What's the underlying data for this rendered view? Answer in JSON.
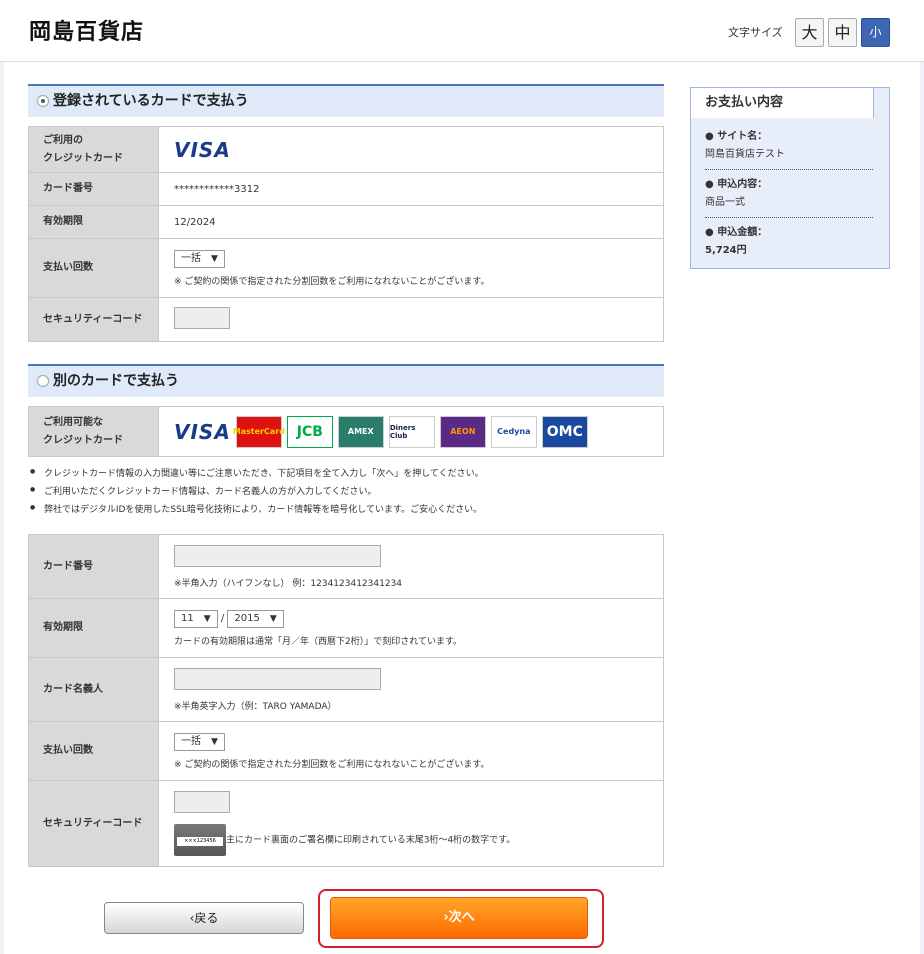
{
  "header": {
    "logo": "岡島百貨店",
    "font_size_label": "文字サイズ",
    "font_size_buttons": [
      "大",
      "中",
      "小"
    ]
  },
  "registered": {
    "heading": "登録されているカードで支払う",
    "card_label": "ご利用の\nクレジットカード",
    "card_brand": "VISA",
    "number_label": "カード番号",
    "number_value": "************3312",
    "expiry_label": "有効期限",
    "expiry_value": "12/2024",
    "installment_label": "支払い回数",
    "installment_value": "一括",
    "installment_note": "※ ご契約の関係で指定された分割回数をご利用になれないことがございます。",
    "security_label": "セキュリティーコード"
  },
  "other": {
    "heading": "別のカードで支払う",
    "available_label": "ご利用可能な\nクレジットカード",
    "brands": [
      "VISA",
      "MasterCard",
      "JCB",
      "AMEX",
      "Diners Club",
      "AEON",
      "Cedyna",
      "OMC"
    ]
  },
  "bullets": [
    "クレジットカード情報の入力間違い等にご注意いただき、下記項目を全て入力し「次へ」を押してください。",
    "ご利用いただくクレジットカード情報は、カード名義人の方が入力してください。",
    "弊社ではデジタルIDを使用したSSL暗号化技術により、カード情報等を暗号化しています。ご安心ください。"
  ],
  "new_card": {
    "number_label": "カード番号",
    "number_note": "※半角入力（ハイフンなし） 例：1234123412341234",
    "expiry_label": "有効期限",
    "expiry_month": "11",
    "expiry_sep": "/",
    "expiry_year": "2015",
    "expiry_note": "カードの有効期限は通常「月／年（西暦下2桁）」で刻印されています。",
    "name_label": "カード名義人",
    "name_note": "※半角英字入力（例：TARO YAMADA）",
    "installment_label": "支払い回数",
    "installment_value": "一括",
    "installment_note": "※ ご契約の関係で指定された分割回数をご利用になれないことがございます。",
    "security_label": "セキュリティーコード",
    "security_card_text": "×××123456",
    "security_note": "主にカード裏面のご署名欄に印刷されている末尾3桁～4桁の数字です。"
  },
  "side": {
    "title": "お支払い内容",
    "items": [
      {
        "label": "サイト名：",
        "value": "岡島百貨店テスト"
      },
      {
        "label": "申込内容：",
        "value": "商品一式"
      },
      {
        "label": "申込金額：",
        "value": "5,724円"
      }
    ]
  },
  "buttons": {
    "back": "‹戻る",
    "next": "›次へ"
  }
}
